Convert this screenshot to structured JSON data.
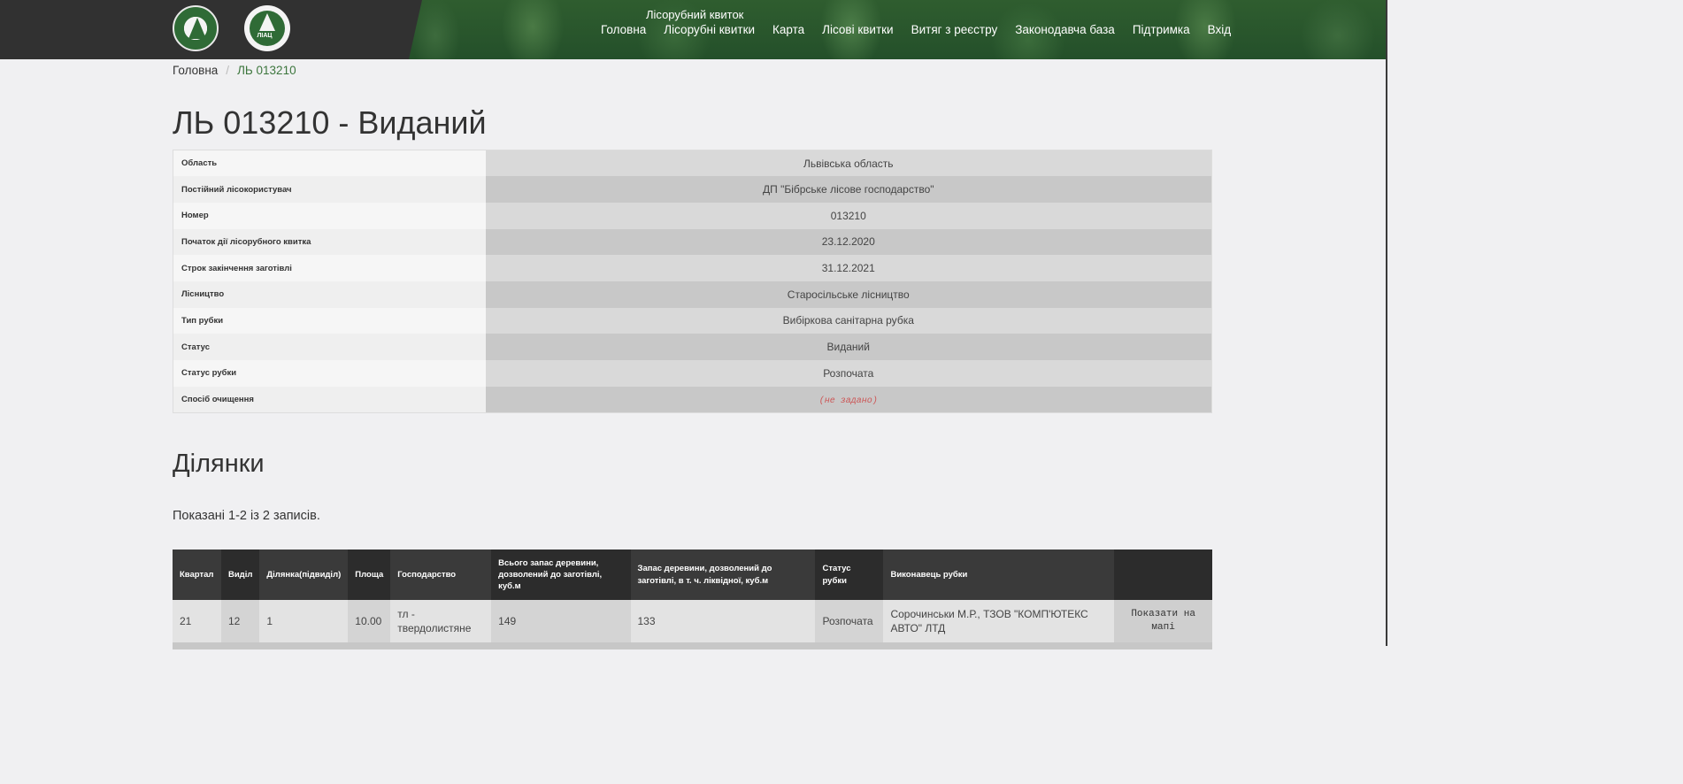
{
  "header": {
    "site_title": "Лісорубний квиток",
    "logo2_text": "ЛІАЦ",
    "nav": [
      "Головна",
      "Лісорубні квитки",
      "Карта",
      "Лісові квитки",
      "Витяг з реєстру",
      "Законодавча база",
      "Підтримка",
      "Вхід"
    ]
  },
  "breadcrumb": {
    "home": "Головна",
    "separator": "/",
    "current": "ЛЬ 013210"
  },
  "page_title": "ЛЬ 013210 - Виданий",
  "details": [
    {
      "label": "Область",
      "value": "Львівська область"
    },
    {
      "label": "Постійний лісокористувач",
      "value": "ДП \"Бібрське лісове господарство\""
    },
    {
      "label": "Номер",
      "value": "013210"
    },
    {
      "label": "Початок дії лісорубного квитка",
      "value": "23.12.2020"
    },
    {
      "label": "Строк закінчення заготівлі",
      "value": "31.12.2021"
    },
    {
      "label": "Лісництво",
      "value": "Старосільське лісництво"
    },
    {
      "label": "Тип рубки",
      "value": "Вибіркова санітарна рубка"
    },
    {
      "label": "Статус",
      "value": "Виданий"
    },
    {
      "label": "Статус рубки",
      "value": "Розпочата"
    },
    {
      "label": "Спосіб очищення",
      "value": "(не задано)"
    }
  ],
  "plots_section": {
    "title": "Ділянки",
    "summary": "Показані 1-2 із 2 записів.",
    "columns": [
      "Квартал",
      "Виділ",
      "Ділянка(підвиділ)",
      "Площа",
      "Господарство",
      "Всього запас деревини, дозволений до заготівлі, куб.м",
      "Запас деревини, дозволений до заготівлі, в т. ч. ліквідної, куб.м",
      "Статус рубки",
      "Виконавець рубки",
      ""
    ],
    "rows": [
      {
        "kvartal": "21",
        "vydil": "12",
        "dilyanka": "1",
        "area": "10.00",
        "gospodarstvo": "тл - твердолистяне",
        "total": "149",
        "liquid": "133",
        "status": "Розпочата",
        "executor": "Сорочинськи М.Р., ТЗОВ \"КОМП'ЮТЕКС АВТО\" ЛТД",
        "action": "Показати на мапі"
      }
    ]
  }
}
